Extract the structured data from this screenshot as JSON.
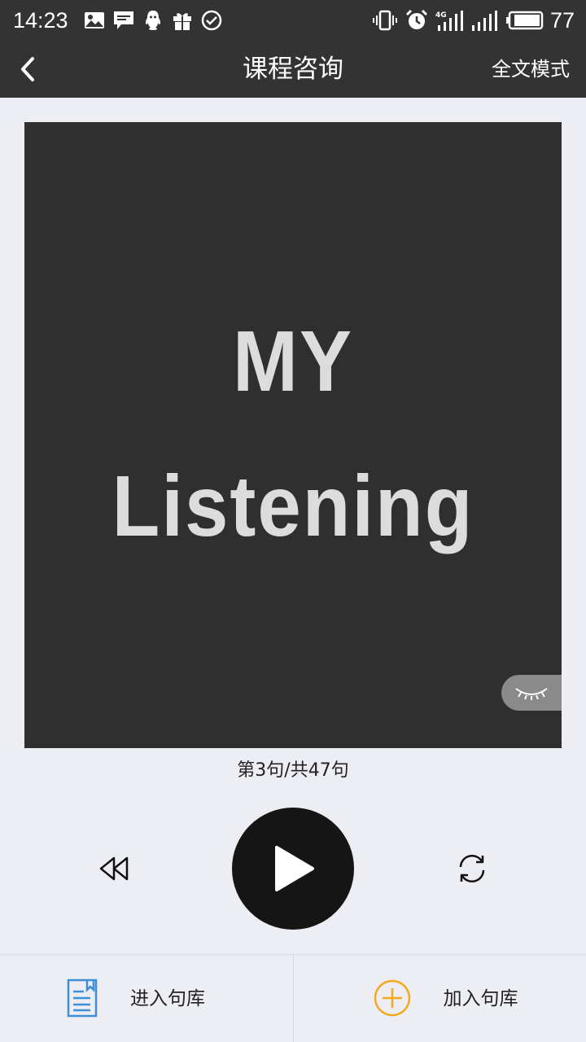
{
  "status_bar": {
    "time": "14:23",
    "battery": "77",
    "left_icons": [
      "image-icon",
      "message-icon",
      "qq-icon",
      "gift-icon",
      "check-circle-icon"
    ],
    "right_icons": [
      "vibrate-icon",
      "alarm-icon",
      "signal-4g-icon",
      "signal-icon",
      "battery-icon"
    ]
  },
  "header": {
    "title": "课程咨询",
    "mode_label": "全文模式",
    "back_icon": "chevron-left-icon"
  },
  "cover": {
    "line1": "MY",
    "line2": "Listening",
    "eye_icon": "closed-eye-icon"
  },
  "counter": "第3句/共47句",
  "controls": {
    "rewind_icon": "rewind-icon",
    "play_icon": "play-icon",
    "loop_icon": "loop-icon"
  },
  "bottom_bar": {
    "enter_label": "进入句库",
    "add_label": "加入句库"
  },
  "colors": {
    "header_bg": "#333333",
    "page_bg": "#eceef3",
    "cover_bg": "#2f2f2f",
    "accent_blue": "#3e8fd8",
    "accent_orange": "#f4a91c"
  }
}
